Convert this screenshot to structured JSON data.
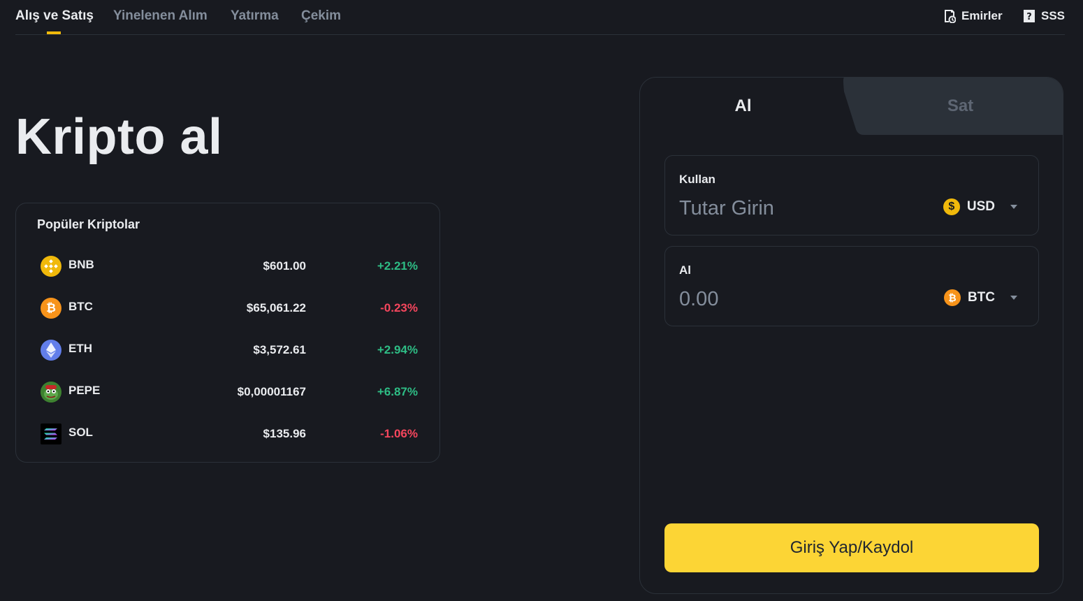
{
  "topnav": {
    "tabs": [
      {
        "label": "Alış ve Satış",
        "active": true
      },
      {
        "label": "Yinelenen Alım",
        "active": false
      },
      {
        "label": "Yatırma",
        "active": false
      },
      {
        "label": "Çekim",
        "active": false
      }
    ],
    "orders_label": "Emirler",
    "faq_label": "SSS",
    "accent_color": "#f0b90b"
  },
  "headline": "Kripto al",
  "popular": {
    "title": "Popüler Kriptolar",
    "coins": [
      {
        "symbol": "BNB",
        "price": "$601.00",
        "change": "+2.21%",
        "direction": "up",
        "icon": "bnb-icon"
      },
      {
        "symbol": "BTC",
        "price": "$65,061.22",
        "change": "-0.23%",
        "direction": "down",
        "icon": "btc-icon"
      },
      {
        "symbol": "ETH",
        "price": "$3,572.61",
        "change": "+2.94%",
        "direction": "up",
        "icon": "eth-icon"
      },
      {
        "symbol": "PEPE",
        "price": "$0,00001167",
        "change": "+6.87%",
        "direction": "up",
        "icon": "pepe-icon"
      },
      {
        "symbol": "SOL",
        "price": "$135.96",
        "change": "-1.06%",
        "direction": "down",
        "icon": "sol-icon"
      }
    ],
    "up_color": "#2ebd85",
    "down_color": "#f6465d"
  },
  "trade": {
    "buy_tab": "Al",
    "sell_tab": "Sat",
    "spend": {
      "label": "Kullan",
      "placeholder": "Tutar Girin",
      "currency": "USD",
      "currency_icon": "usd-coin-icon"
    },
    "receive": {
      "label": "Al",
      "value": "0.00",
      "currency": "BTC",
      "currency_icon": "btc-icon"
    },
    "login_button": "Giriş Yap/Kaydol",
    "button_color": "#fcd535"
  }
}
